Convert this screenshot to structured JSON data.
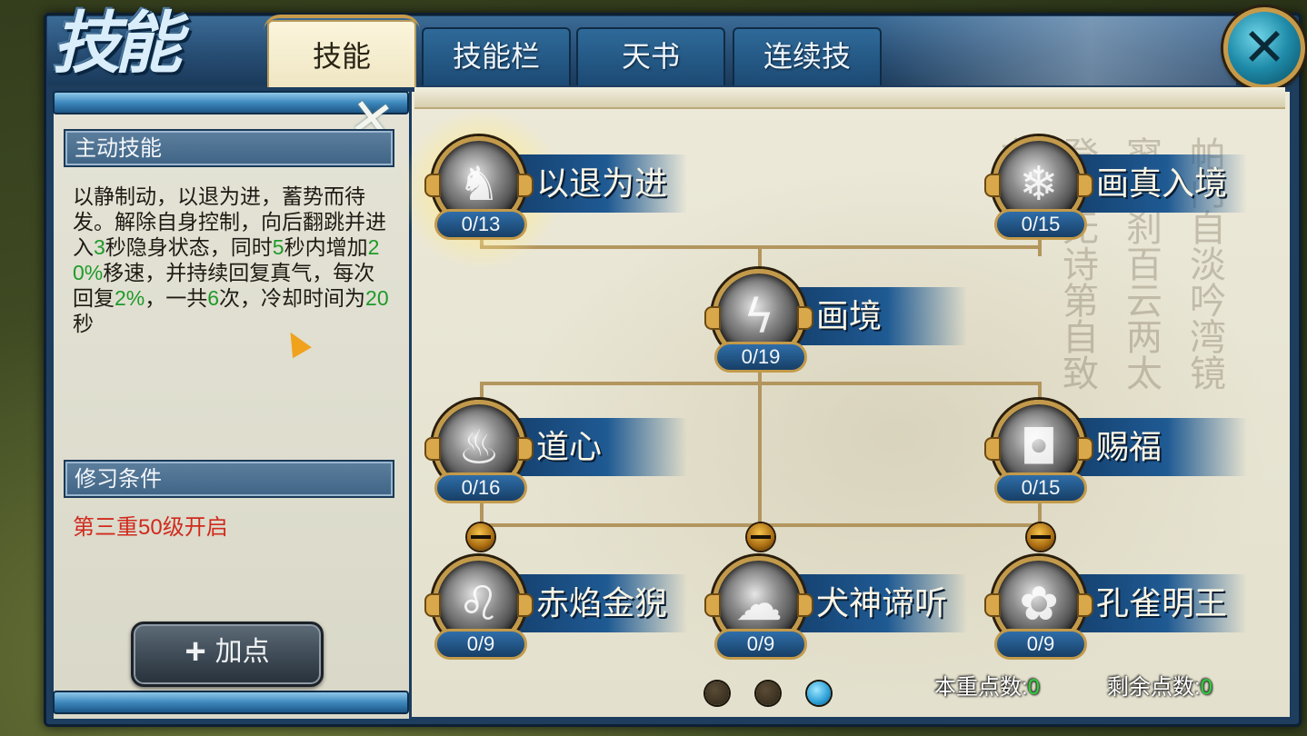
{
  "window": {
    "title_art": "技能"
  },
  "tabs": [
    {
      "label": "技能",
      "active": true
    },
    {
      "label": "技能栏",
      "active": false
    },
    {
      "label": "天书",
      "active": false
    },
    {
      "label": "连续技",
      "active": false
    }
  ],
  "close_icon": "close-icon",
  "left_panel": {
    "active_section_title": "主动技能",
    "description_parts": [
      {
        "text": "以静制动，以退为进，蓄势而待发。解除自身控制，向后翻跳并进入",
        "highlight": false
      },
      {
        "text": "3",
        "highlight": true
      },
      {
        "text": "秒隐身状态，同时",
        "highlight": false
      },
      {
        "text": "5",
        "highlight": true
      },
      {
        "text": "秒内增加",
        "highlight": false
      },
      {
        "text": "20%",
        "highlight": true
      },
      {
        "text": "移速，并持续回复真气，每次回复",
        "highlight": false
      },
      {
        "text": "2%",
        "highlight": true
      },
      {
        "text": "，一共",
        "highlight": false
      },
      {
        "text": "6",
        "highlight": true
      },
      {
        "text": "次，冷却时间为",
        "highlight": false
      },
      {
        "text": "20",
        "highlight": true
      },
      {
        "text": "秒",
        "highlight": false
      }
    ],
    "requirement_title": "修习条件",
    "requirement_text": "第三重50级开启",
    "add_point_label": "加点",
    "add_point_icon": "plus-icon"
  },
  "skills": [
    {
      "id": "yituiweijin",
      "name": "以退为进",
      "level": "0/13",
      "selected": true,
      "locked": false,
      "icon": "shadow-figure-icon"
    },
    {
      "id": "huazhenrujing",
      "name": "画真入境",
      "level": "0/15",
      "selected": false,
      "locked": false,
      "icon": "mist-icon"
    },
    {
      "id": "huajing",
      "name": "画境",
      "level": "0/19",
      "selected": false,
      "locked": false,
      "icon": "lightning-icon"
    },
    {
      "id": "daoxin",
      "name": "道心",
      "level": "0/16",
      "selected": false,
      "locked": false,
      "icon": "flame-figure-icon"
    },
    {
      "id": "cifu",
      "name": "赐福",
      "level": "0/15",
      "selected": false,
      "locked": false,
      "icon": "shield-icon"
    },
    {
      "id": "chiyanjinni",
      "name": "赤焰金猊",
      "level": "0/9",
      "selected": false,
      "locked": true,
      "icon": "lion-icon"
    },
    {
      "id": "quanshenditing",
      "name": "犬神谛听",
      "level": "0/9",
      "selected": false,
      "locked": true,
      "icon": "beast-icon"
    },
    {
      "id": "kongquemingwang",
      "name": "孔雀明王",
      "level": "0/9",
      "selected": false,
      "locked": true,
      "icon": "peacock-icon"
    }
  ],
  "pagination": {
    "pages": 3,
    "current": 3
  },
  "points": {
    "current_label": "本重点数:",
    "current_value": "0",
    "remaining_label": "剩余点数:",
    "remaining_value": "0"
  },
  "calligraphy_text": "帕门自淡吟湾镜寥碧刹百云两太登门无诗第自致之"
}
